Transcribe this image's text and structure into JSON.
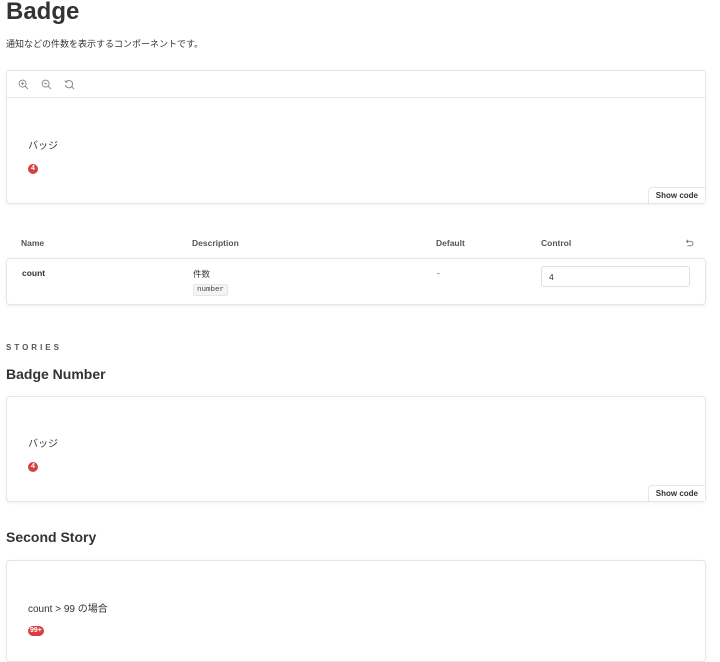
{
  "page": {
    "title": "Badge",
    "subtitle": "通知などの件数を表示するコンポーネントです。"
  },
  "toolbar": {
    "zoom_in_icon": "zoom-in-icon",
    "zoom_out_icon": "zoom-out-icon",
    "zoom_reset_icon": "zoom-reset-icon"
  },
  "primary_preview": {
    "label": "バッジ",
    "badge_value": "4",
    "show_code_label": "Show code"
  },
  "args_table": {
    "headers": {
      "name": "Name",
      "description": "Description",
      "default": "Default",
      "control": "Control"
    },
    "reset_icon": "undo-icon",
    "rows": [
      {
        "name": "count",
        "description": "件数",
        "type": "number",
        "default": "-",
        "control_value": "4"
      }
    ]
  },
  "stories": {
    "kicker": "STORIES",
    "items": [
      {
        "title": "Badge Number",
        "label": "バッジ",
        "badge_value": "4",
        "show_code_label": "Show code"
      },
      {
        "title": "Second Story",
        "label": "count > 99 の場合",
        "badge_value": "99+"
      }
    ]
  },
  "colors": {
    "badge_bg": "#d84040",
    "border": "#e4e6e8",
    "text": "#333333"
  }
}
